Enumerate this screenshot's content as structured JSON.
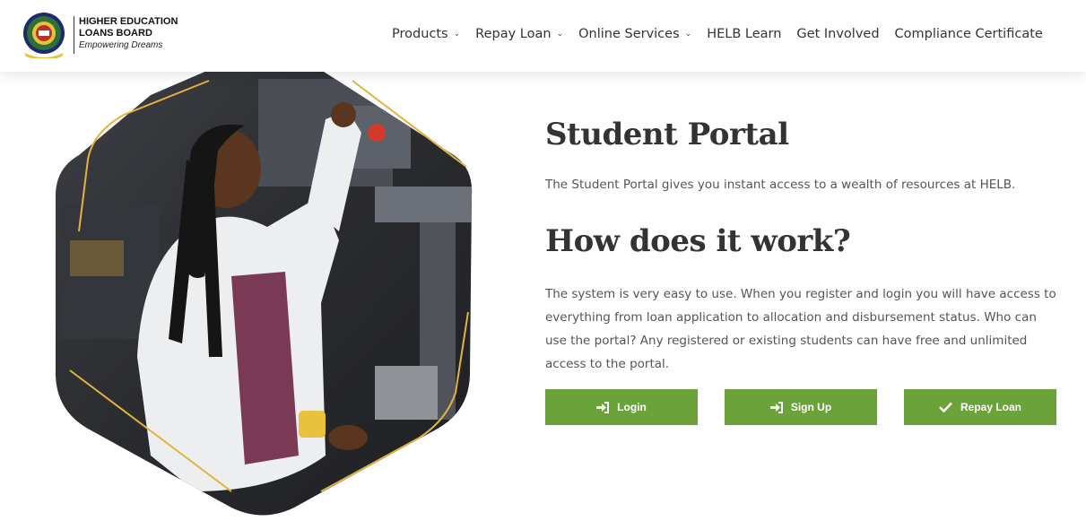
{
  "header": {
    "brand_line1": "HIGHER EDUCATION",
    "brand_line2": "LOANS BOARD",
    "brand_tagline": "Empowering Dreams",
    "nav": [
      {
        "label": "Products",
        "has_dropdown": true
      },
      {
        "label": "Repay Loan",
        "has_dropdown": true
      },
      {
        "label": "Online Services",
        "has_dropdown": true
      },
      {
        "label": "HELB Learn",
        "has_dropdown": false
      },
      {
        "label": "Get Involved",
        "has_dropdown": false
      },
      {
        "label": "Compliance Certificate",
        "has_dropdown": false
      }
    ]
  },
  "main": {
    "title": "Student Portal",
    "intro": "The Student Portal gives you instant access to a wealth of resources at HELB.",
    "subtitle": "How does it work?",
    "description": "The system is very easy to use. When you register and login you will have access to everything from loan application to allocation and disbursement status. Who can use the portal? Any registered or existing students can have free and unlimited access to the portal.",
    "buttons": [
      {
        "label": "Login",
        "icon": "sign-in-icon"
      },
      {
        "label": "Sign Up",
        "icon": "sign-in-icon"
      },
      {
        "label": "Repay Loan",
        "icon": "checkmark-icon"
      }
    ]
  },
  "colors": {
    "accent_green": "#6ba33a",
    "accent_gold": "#e3b341",
    "heading": "#333333"
  }
}
